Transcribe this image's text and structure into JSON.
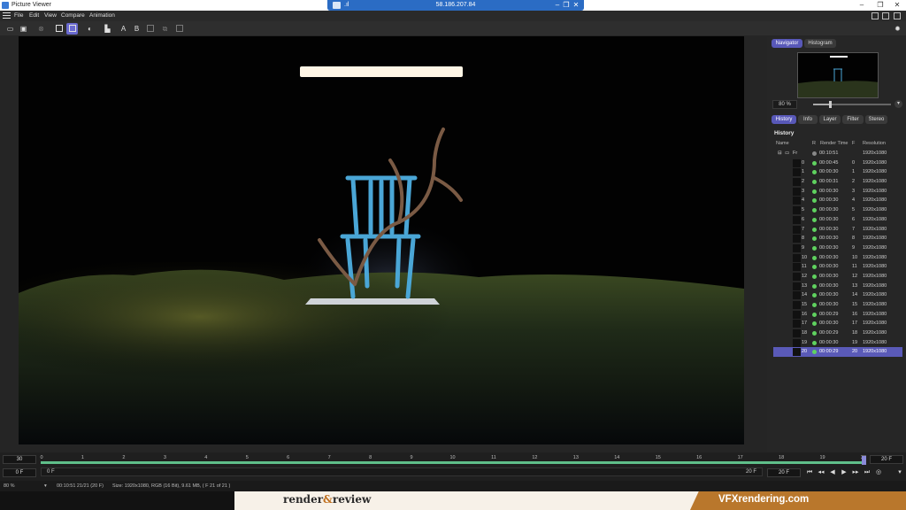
{
  "window": {
    "title": "Picture Viewer",
    "remote_ip": "58.186.207.84",
    "remote_signal": ".ıl"
  },
  "menu": [
    "File",
    "Edit",
    "View",
    "Compare",
    "Animation"
  ],
  "colors": {
    "accent": "#5a5ab8",
    "track": "#5fbf8a",
    "status_ok": "#5fd25f",
    "watermark_orange": "#b9772c"
  },
  "toolbar": {
    "icons": [
      "open-folder-icon",
      "save-icon",
      "stop-icon",
      "region-icon",
      "region-active-icon",
      "contrast-icon",
      "channel-icon",
      "channel-a-icon",
      "channel-b-icon",
      "copy-icon",
      "compare-icon"
    ],
    "channel_a": "A",
    "channel_b": "B"
  },
  "panel": {
    "tabs_top": [
      "Navigator",
      "Histogram"
    ],
    "active_top": "Navigator",
    "zoom": "80 %",
    "zoom_level": 0.22,
    "tabs_mid": [
      "History",
      "Info",
      "Layer",
      "Filter",
      "Stereo"
    ],
    "active_mid": "History",
    "section_title": "History",
    "columns": {
      "name": "Name",
      "r": "R",
      "render_time": "Render Time",
      "f": "F",
      "resolution": "Resolution"
    },
    "group": {
      "name": "Fr",
      "time": "00:10:51",
      "res": "1920x1080"
    },
    "rows": [
      {
        "n": "0",
        "time": "00:00:45",
        "f": "0",
        "res": "1920x1080"
      },
      {
        "n": "1",
        "time": "00:00:30",
        "f": "1",
        "res": "1920x1080"
      },
      {
        "n": "2",
        "time": "00:00:31",
        "f": "2",
        "res": "1920x1080"
      },
      {
        "n": "3",
        "time": "00:00:30",
        "f": "3",
        "res": "1920x1080"
      },
      {
        "n": "4",
        "time": "00:00:30",
        "f": "4",
        "res": "1920x1080"
      },
      {
        "n": "5",
        "time": "00:00:30",
        "f": "5",
        "res": "1920x1080"
      },
      {
        "n": "6",
        "time": "00:00:30",
        "f": "6",
        "res": "1920x1080"
      },
      {
        "n": "7",
        "time": "00:00:30",
        "f": "7",
        "res": "1920x1080"
      },
      {
        "n": "8",
        "time": "00:00:30",
        "f": "8",
        "res": "1920x1080"
      },
      {
        "n": "9",
        "time": "00:00:30",
        "f": "9",
        "res": "1920x1080"
      },
      {
        "n": "10",
        "time": "00:00:30",
        "f": "10",
        "res": "1920x1080"
      },
      {
        "n": "11",
        "time": "00:00:30",
        "f": "11",
        "res": "1920x1080"
      },
      {
        "n": "12",
        "time": "00:00:30",
        "f": "12",
        "res": "1920x1080"
      },
      {
        "n": "13",
        "time": "00:00:30",
        "f": "13",
        "res": "1920x1080"
      },
      {
        "n": "14",
        "time": "00:00:30",
        "f": "14",
        "res": "1920x1080"
      },
      {
        "n": "15",
        "time": "00:00:30",
        "f": "15",
        "res": "1920x1080"
      },
      {
        "n": "16",
        "time": "00:00:29",
        "f": "16",
        "res": "1920x1080"
      },
      {
        "n": "17",
        "time": "00:00:30",
        "f": "17",
        "res": "1920x1080"
      },
      {
        "n": "18",
        "time": "00:00:29",
        "f": "18",
        "res": "1920x1080"
      },
      {
        "n": "19",
        "time": "00:00:30",
        "f": "19",
        "res": "1920x1080"
      },
      {
        "n": "20",
        "time": "00:00:29",
        "f": "20",
        "res": "1920x1080"
      }
    ],
    "selected_row": "20"
  },
  "timeline": {
    "fps": "30",
    "start": "0 F",
    "range_start": "0 F",
    "range_end": "20 F",
    "current": "20 F",
    "end_field": "20 F",
    "ticks": [
      "0",
      "1",
      "2",
      "3",
      "4",
      "5",
      "6",
      "7",
      "8",
      "9",
      "10",
      "11",
      "12",
      "13",
      "14",
      "15",
      "16",
      "17",
      "18",
      "19",
      "20"
    ],
    "current_frame": 20
  },
  "status": {
    "zoom": "80 %",
    "time_frame": "00:10:51 21/21 (20 F)",
    "info": "Size: 1920x1080, RGB (16 Bit), 9.61 MB,  ( F 21 of 21 )"
  },
  "watermark": {
    "logo_left": "render",
    "logo_amp": "&",
    "logo_right": "review",
    "site": "VFXrendering.com"
  }
}
